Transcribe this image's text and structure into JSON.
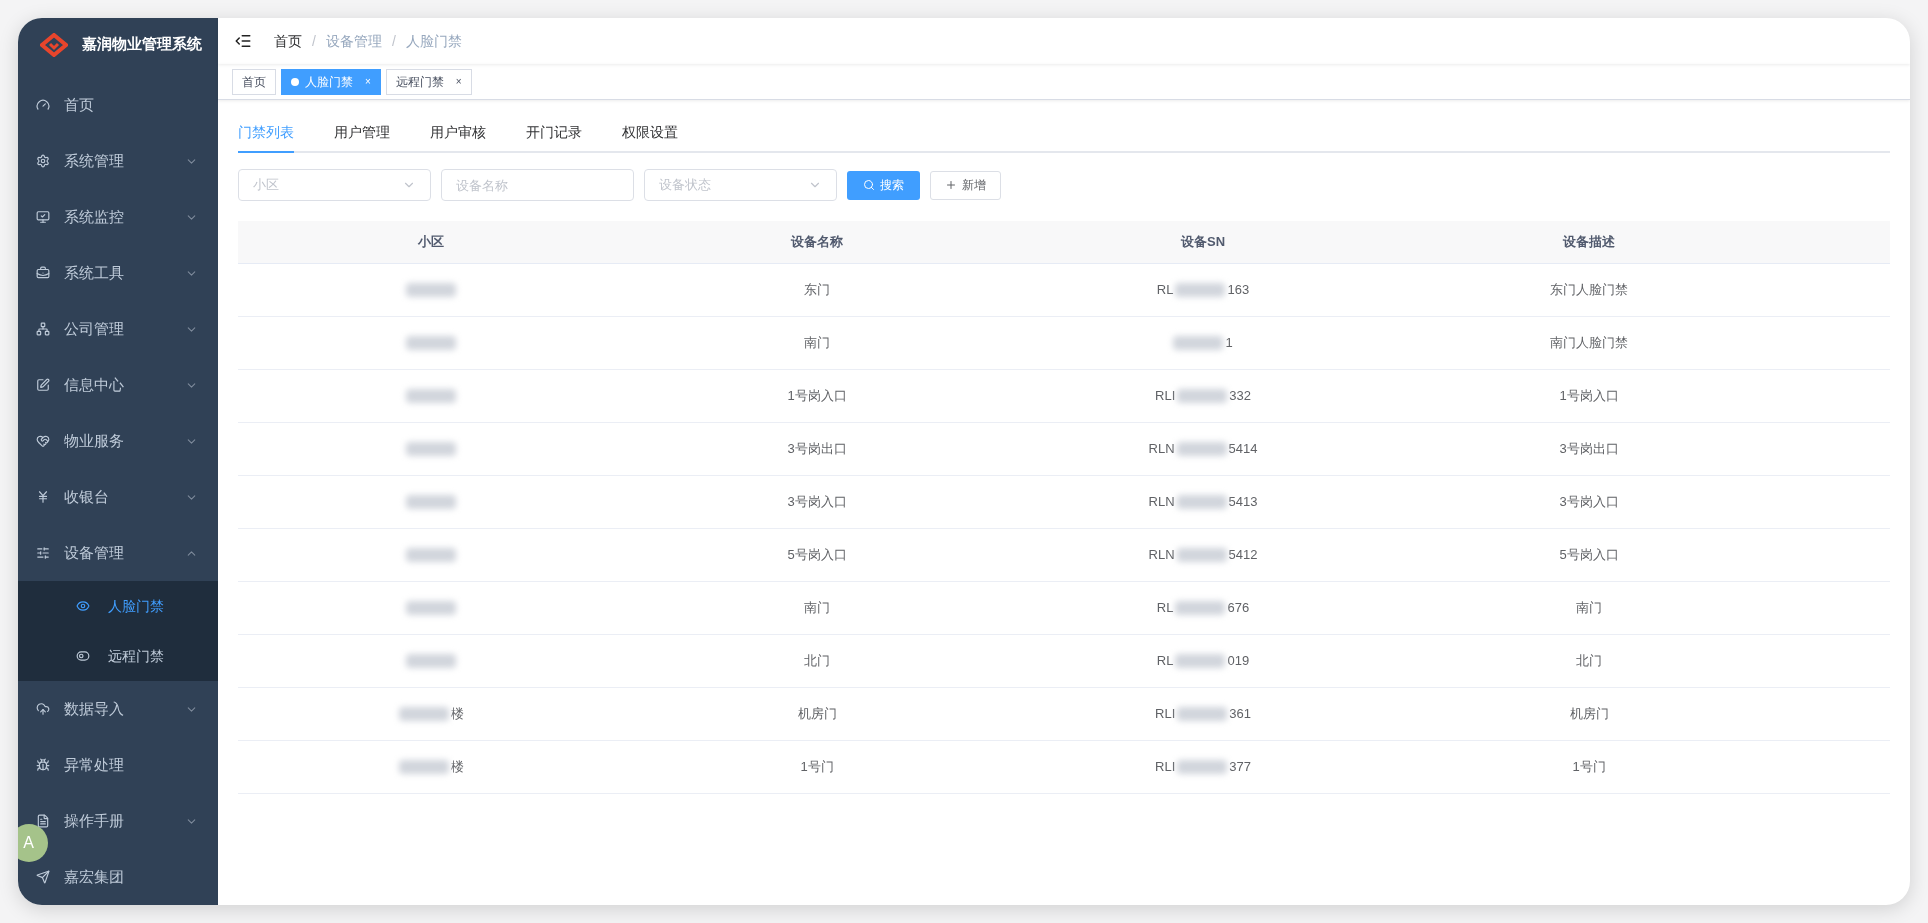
{
  "sidebar": {
    "title": "嘉润物业管理系统",
    "items": [
      {
        "label": "首页",
        "expandable": false
      },
      {
        "label": "系统管理",
        "expandable": true,
        "expanded": false
      },
      {
        "label": "系统监控",
        "expandable": true,
        "expanded": false
      },
      {
        "label": "系统工具",
        "expandable": true,
        "expanded": false
      },
      {
        "label": "公司管理",
        "expandable": true,
        "expanded": false
      },
      {
        "label": "信息中心",
        "expandable": true,
        "expanded": false
      },
      {
        "label": "物业服务",
        "expandable": true,
        "expanded": false
      },
      {
        "label": "收银台",
        "expandable": true,
        "expanded": false
      },
      {
        "label": "设备管理",
        "expandable": true,
        "expanded": true,
        "children": [
          {
            "label": "人脸门禁",
            "selected": true
          },
          {
            "label": "远程门禁",
            "selected": false
          }
        ]
      },
      {
        "label": "数据导入",
        "expandable": true,
        "expanded": false
      },
      {
        "label": "异常处理",
        "expandable": false
      },
      {
        "label": "操作手册",
        "expandable": true,
        "expanded": false
      },
      {
        "label": "嘉宏集团",
        "expandable": false
      }
    ]
  },
  "floating_badge": {
    "label": "A"
  },
  "breadcrumb": [
    {
      "label": "首页"
    },
    {
      "label": "设备管理",
      "separator": "/"
    },
    {
      "label": "人脸门禁",
      "separator": "/"
    }
  ],
  "tags": [
    {
      "label": "首页",
      "selected": false,
      "closable": false
    },
    {
      "label": "人脸门禁",
      "selected": true,
      "closable": true,
      "close": "×"
    },
    {
      "label": "远程门禁",
      "selected": false,
      "closable": true,
      "close": "×"
    }
  ],
  "tabs": [
    {
      "label": "门禁列表",
      "selected": true
    },
    {
      "label": "用户管理",
      "selected": false
    },
    {
      "label": "用户审核",
      "selected": false
    },
    {
      "label": "开门记录",
      "selected": false
    },
    {
      "label": "权限设置",
      "selected": false
    }
  ],
  "filters": [
    {
      "kind": "select",
      "placeholder": "小区"
    },
    {
      "kind": "input",
      "placeholder": "设备名称"
    },
    {
      "kind": "select",
      "placeholder": "设备状态"
    }
  ],
  "buttons": [
    {
      "kind": "primary",
      "label": "搜索"
    },
    {
      "kind": "default",
      "label": "新增"
    }
  ],
  "table": {
    "columns": [
      "小区",
      "设备名称",
      "设备SN",
      "设备描述"
    ],
    "rows": [
      {
        "name": "东门",
        "sn_prefix": "RL",
        "sn_suffix": "163",
        "description": "东门人脸门禁"
      },
      {
        "name": "南门",
        "sn_suffix": "1",
        "description": "南门人脸门禁"
      },
      {
        "name": "1号岗入口",
        "sn_prefix": "RLI",
        "sn_suffix": "332",
        "description": "1号岗入口"
      },
      {
        "name": "3号岗出口",
        "sn_prefix": "RLN",
        "sn_suffix": "5414",
        "description": "3号岗出口"
      },
      {
        "name": "3号岗入口",
        "sn_prefix": "RLN",
        "sn_suffix": "5413",
        "description": "3号岗入口"
      },
      {
        "name": "5号岗入口",
        "sn_prefix": "RLN",
        "sn_suffix": "5412",
        "description": "5号岗入口"
      },
      {
        "name": "南门",
        "sn_prefix": "RL",
        "sn_suffix": "676",
        "description": "南门"
      },
      {
        "name": "北门",
        "sn_prefix": "RL",
        "sn_suffix": "019",
        "description": "北门"
      },
      {
        "community_suffix": "楼",
        "name": "机房门",
        "sn_prefix": "RLI",
        "sn_suffix": "361",
        "description": "机房门"
      },
      {
        "community_suffix": "楼",
        "name": "1号门",
        "sn_prefix": "RLI",
        "sn_suffix": "377",
        "description": "1号门"
      }
    ]
  }
}
